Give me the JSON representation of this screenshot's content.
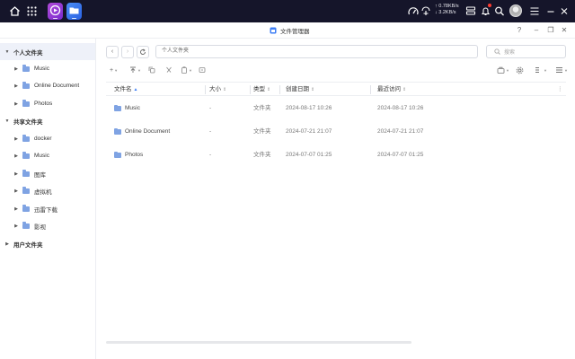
{
  "window": {
    "title": "文件管理器"
  },
  "sysbar": {
    "upload_speed": "↑ 0.78KB/s",
    "download_speed": "↓ 3.2KB/s"
  },
  "toolbar": {
    "path_placeholder": "个人文件夹",
    "search_placeholder": "搜索"
  },
  "sidebar": {
    "groups": [
      {
        "label": "个人文件夹",
        "items": [
          "Music",
          "Online Document",
          "Photos"
        ]
      },
      {
        "label": "共享文件夹",
        "items": [
          "docker",
          "Music",
          "图库",
          "虚拟机",
          "迅雷下载",
          "影视"
        ]
      },
      {
        "label": "用户文件夹",
        "items": []
      }
    ]
  },
  "table": {
    "columns": [
      "文件名",
      "大小",
      "类型",
      "创建日期",
      "最近访问"
    ],
    "rows": [
      {
        "name": "Music",
        "size": "-",
        "type": "文件夹",
        "created": "2024-08-17 10:26",
        "accessed": "2024-08-17 10:26"
      },
      {
        "name": "Online Document",
        "size": "-",
        "type": "文件夹",
        "created": "2024-07-21 21:07",
        "accessed": "2024-07-21 21:07"
      },
      {
        "name": "Photos",
        "size": "-",
        "type": "文件夹",
        "created": "2024-07-07 01:25",
        "accessed": "2024-07-07 01:25"
      }
    ]
  }
}
